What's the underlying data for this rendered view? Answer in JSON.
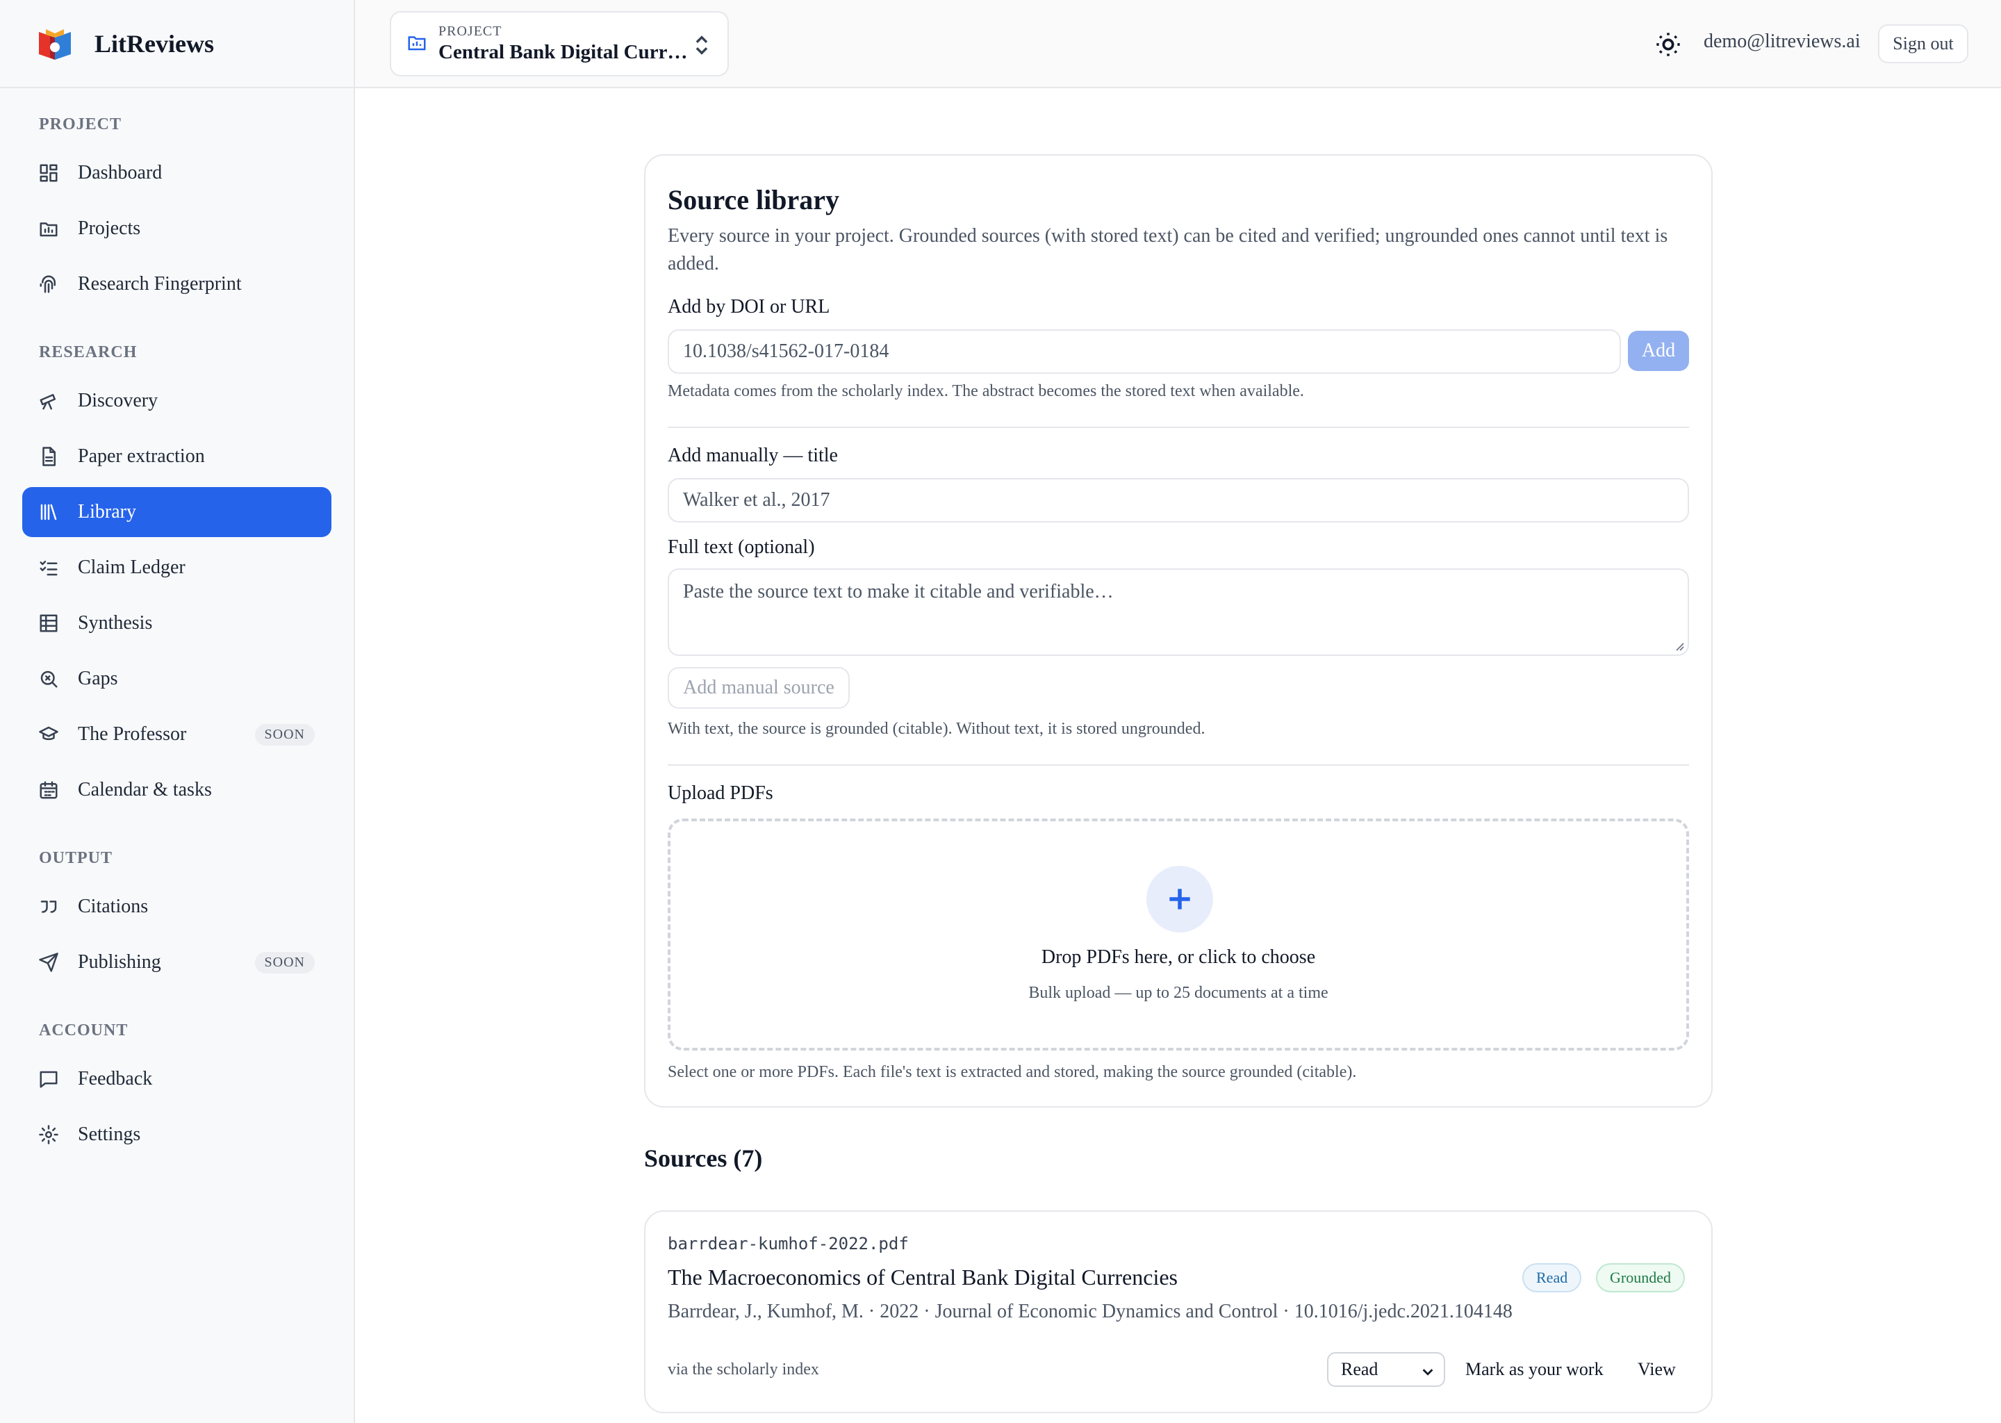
{
  "brand": {
    "name": "LitReviews"
  },
  "header": {
    "project_label": "PROJECT",
    "project_name": "Central Bank Digital Curr…",
    "user_email": "demo@litreviews.ai",
    "signout_label": "Sign out"
  },
  "sidebar": {
    "sections": [
      {
        "title": "PROJECT",
        "items": [
          {
            "label": "Dashboard",
            "icon": "dashboard-icon"
          },
          {
            "label": "Projects",
            "icon": "folder-icon"
          },
          {
            "label": "Research Fingerprint",
            "icon": "fingerprint-icon"
          }
        ]
      },
      {
        "title": "RESEARCH",
        "items": [
          {
            "label": "Discovery",
            "icon": "telescope-icon"
          },
          {
            "label": "Paper extraction",
            "icon": "document-icon"
          },
          {
            "label": "Library",
            "icon": "library-icon",
            "active": true
          },
          {
            "label": "Claim Ledger",
            "icon": "checklist-icon"
          },
          {
            "label": "Synthesis",
            "icon": "table-icon"
          },
          {
            "label": "Gaps",
            "icon": "search-x-icon"
          },
          {
            "label": "The Professor",
            "icon": "graduation-cap-icon",
            "badge": "SOON"
          },
          {
            "label": "Calendar & tasks",
            "icon": "calendar-icon"
          }
        ]
      },
      {
        "title": "OUTPUT",
        "items": [
          {
            "label": "Citations",
            "icon": "quote-icon"
          },
          {
            "label": "Publishing",
            "icon": "send-icon",
            "badge": "SOON"
          }
        ]
      },
      {
        "title": "ACCOUNT",
        "items": [
          {
            "label": "Feedback",
            "icon": "message-icon"
          },
          {
            "label": "Settings",
            "icon": "gear-icon"
          }
        ]
      }
    ]
  },
  "library": {
    "title": "Source library",
    "description": "Every source in your project. Grounded sources (with stored text) can be cited and verified; ungrounded ones cannot until text is added.",
    "doi_label": "Add by DOI or URL",
    "doi_placeholder": "10.1038/s41562-017-0184",
    "add_label": "Add",
    "doi_hint": "Metadata comes from the scholarly index. The abstract becomes the stored text when available.",
    "manual_label": "Add manually — title",
    "manual_placeholder": "Walker et al., 2017",
    "fulltext_label": "Full text (optional)",
    "fulltext_placeholder": "Paste the source text to make it citable and verifiable…",
    "manual_button": "Add manual source",
    "manual_hint": "With text, the source is grounded (citable). Without text, it is stored ungrounded.",
    "upload_label": "Upload PDFs",
    "drop_title": "Drop PDFs here, or click to choose",
    "drop_sub": "Bulk upload — up to 25 documents at a time",
    "upload_hint": "Select one or more PDFs. Each file's text is extracted and stored, making the source grounded (citable)."
  },
  "sources": {
    "heading": "Sources (7)",
    "items": [
      {
        "filename": "barrdear-kumhof-2022.pdf",
        "title": "The Macroeconomics of Central Bank Digital Currencies",
        "badges": [
          "Read",
          "Grounded"
        ],
        "meta": "Barrdear, J., Kumhof, M. · 2022 · Journal of Economic Dynamics and Control · 10.1016/j.jedc.2021.104148",
        "via": "via the scholarly index",
        "status": "Read",
        "mark_label": "Mark as your work",
        "view_label": "View"
      }
    ]
  },
  "colors": {
    "accent": "#2563eb",
    "sidebar_bg": "#f8f9fb",
    "border": "#e5e7eb"
  }
}
